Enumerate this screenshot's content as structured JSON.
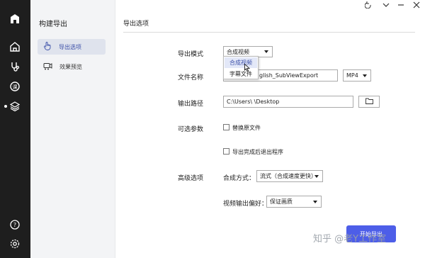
{
  "sidebar": {
    "heading": "构建导出",
    "items": [
      {
        "label": "导出选项",
        "icon": "hand-pointer-icon",
        "active": true
      },
      {
        "label": "效果预览",
        "icon": "video-camera-icon",
        "active": false
      }
    ]
  },
  "rail_icons": [
    "logo-icon",
    "home-icon",
    "stethoscope-icon",
    "lesson-icon",
    "layers-icon",
    "help-icon",
    "settings-icon"
  ],
  "main": {
    "title": "导出选项",
    "export_mode": {
      "label": "导出模式",
      "value": "合成视频",
      "options": [
        "合成视频",
        "字幕文件"
      ],
      "hovered": "合成视频"
    },
    "file_name": {
      "label": "文件名称",
      "value": "glish_SubViewExport",
      "format": "MP4"
    },
    "output_path": {
      "label": "输出路径",
      "value": "C:\\Users\\        \\Desktop"
    },
    "optional_params": {
      "label": "可选参数",
      "replace_original": "替换原文件",
      "exit_after_export": "导出完成后退出程序"
    },
    "advanced": {
      "label": "高级选项",
      "compose_mode_label": "合成方式：",
      "compose_mode_value": "流式（合成速度更快）",
      "video_pref_label": "视频输出偏好：",
      "video_pref_value": "保证画质"
    },
    "start_button": "开始导出"
  },
  "watermark": "知乎 @老Y工作室",
  "colors": {
    "accent": "#4d5ee8",
    "rail": "#1e1e1e",
    "sidebar": "#f3f4f6"
  }
}
